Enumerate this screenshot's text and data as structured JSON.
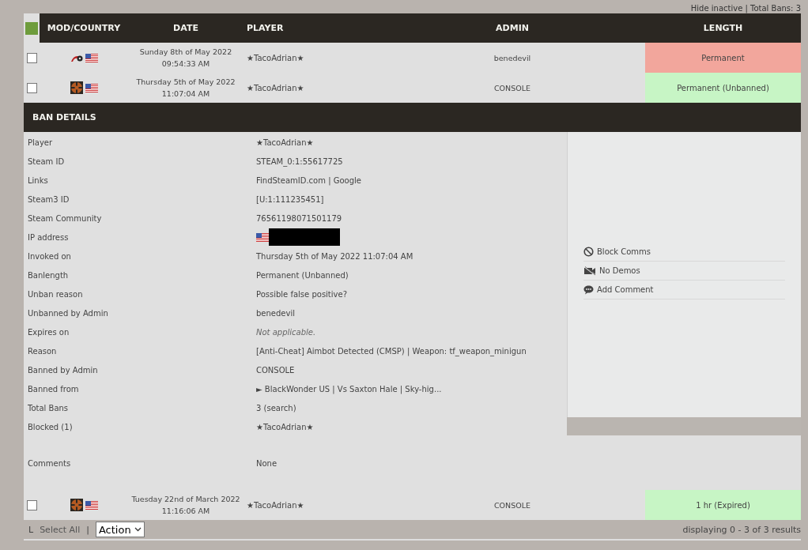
{
  "top_links": "Hide inactive | Total Bans: 3",
  "table": {
    "columns": [
      "MOD/COUNTRY",
      "DATE",
      "PLAYER",
      "ADMIN",
      "LENGTH"
    ],
    "rows": [
      {
        "checked": false,
        "kind": "generic",
        "date": "Sunday 8th of May 2022 09:54:33 AM",
        "player": "★TacoAdrian★",
        "admin": "benedevil",
        "length": "Permanent",
        "color": "#f2a69c"
      },
      {
        "checked": false,
        "kind": "tf2",
        "date": "Thursday 5th of May 2022 11:07:04 AM",
        "player": "★TacoAdrian★",
        "admin": "CONSOLE",
        "length": "Permanent (Unbanned)",
        "color": "#c7f5c5"
      }
    ]
  },
  "ban_details": {
    "title": "BAN DETAILS",
    "fields": [
      {
        "label": "Player",
        "kind": "text",
        "value": "★TacoAdrian★"
      },
      {
        "label": "Steam ID",
        "kind": "text",
        "value": "STEAM_0:1:55617725"
      },
      {
        "label": "Links",
        "kind": "text",
        "value": "FindSteamID.com | Google"
      },
      {
        "label": "Steam3 ID",
        "kind": "text",
        "value": "[U:1:111235451]"
      },
      {
        "label": "Steam Community",
        "kind": "text",
        "value": "76561198071501179"
      },
      {
        "label": "IP address",
        "kind": "ip"
      },
      {
        "label": "Invoked on",
        "kind": "text",
        "value": "Thursday 5th of May 2022 11:07:04 AM"
      },
      {
        "label": "Banlength",
        "kind": "text",
        "value": "Permanent (Unbanned)"
      },
      {
        "label": "Unban reason",
        "kind": "text",
        "value": "Possible false positive?"
      },
      {
        "label": "Unbanned by Admin",
        "kind": "text",
        "value": "benedevil"
      },
      {
        "label": "Expires on",
        "kind": "muted",
        "value": "Not applicable."
      },
      {
        "label": "Reason",
        "kind": "text",
        "value": "[Anti-Cheat] Aimbot Detected (CMSP) | Weapon: tf_weapon_minigun"
      },
      {
        "label": "Banned by Admin",
        "kind": "text",
        "value": "CONSOLE"
      },
      {
        "label": "Banned from",
        "kind": "text",
        "value": "► BlackWonder US | Vs Saxton Hale | Sky-hig..."
      },
      {
        "label": "Total Bans",
        "kind": "text",
        "value": "3 (search)"
      },
      {
        "label": "Blocked (1)",
        "kind": "text",
        "value": "★TacoAdrian★"
      }
    ],
    "comments": {
      "label": "Comments",
      "value": "None"
    },
    "actions": [
      {
        "kind": "block",
        "label": "Block Comms"
      },
      {
        "kind": "no-video",
        "label": "No Demos"
      },
      {
        "kind": "comment",
        "label": "Add Comment"
      }
    ]
  },
  "last_row": {
    "checked": false,
    "kind": "tf2",
    "date": "Tuesday 22nd of March 2022 11:16:06 AM",
    "player": "★TacoAdrian★",
    "admin": "CONSOLE",
    "length": "1 hr (Expired)",
    "color": "#c7f5c5"
  },
  "footer": {
    "marker": "L",
    "select_all": "Select All",
    "separator": "|",
    "action": "Action",
    "results": "displaying 0 - 3 of 3 results"
  }
}
